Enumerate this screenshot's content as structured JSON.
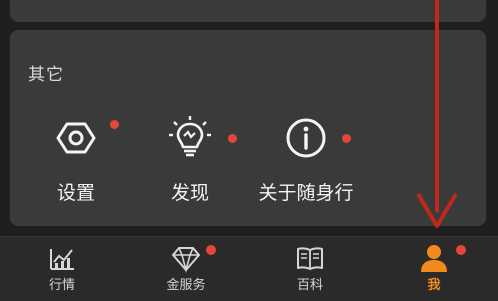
{
  "section": {
    "title": "其它",
    "items": [
      {
        "label": "设置",
        "icon": "settings-icon"
      },
      {
        "label": "发现",
        "icon": "lightbulb-icon"
      },
      {
        "label": "关于随身行",
        "icon": "info-icon"
      }
    ]
  },
  "tabbar": {
    "tabs": [
      {
        "label": "行情",
        "icon": "chart-icon"
      },
      {
        "label": "金服务",
        "icon": "diamond-icon"
      },
      {
        "label": "百科",
        "icon": "book-icon"
      },
      {
        "label": "我",
        "icon": "user-icon"
      }
    ],
    "active_index": 3
  },
  "colors": {
    "accent": "#f08a1c",
    "badge": "#e5463c",
    "annotation_arrow": "#c0281c"
  }
}
